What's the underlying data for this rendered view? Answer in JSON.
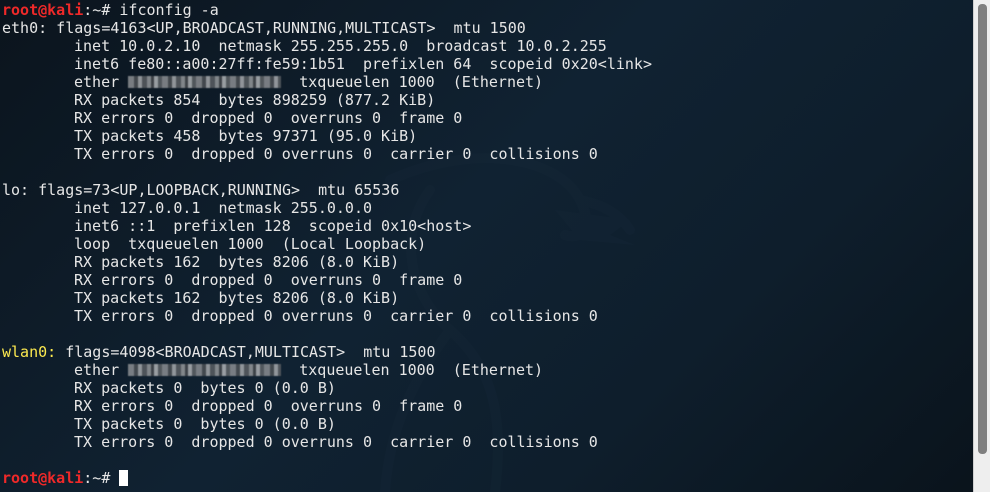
{
  "prompt": {
    "user": "root",
    "at": "@",
    "host": "kali",
    "sep": ":~# "
  },
  "command": "ifconfig -a",
  "eth0": {
    "header": "eth0: flags=4163<UP,BROADCAST,RUNNING,MULTICAST>  mtu 1500",
    "inet": "inet 10.0.2.10  netmask 255.255.255.0  broadcast 10.0.2.255",
    "inet6": "inet6 fe80::a00:27ff:fe59:1b51  prefixlen 64  scopeid 0x20<link>",
    "ether_label": "ether",
    "ether_rest": "txqueuelen 1000  (Ethernet)",
    "rx_packets": "RX packets 854  bytes 898259 (877.2 KiB)",
    "rx_errors": "RX errors 0  dropped 0  overruns 0  frame 0",
    "tx_packets": "TX packets 458  bytes 97371 (95.0 KiB)",
    "tx_errors": "TX errors 0  dropped 0 overruns 0  carrier 0  collisions 0"
  },
  "lo": {
    "header": "lo: flags=73<UP,LOOPBACK,RUNNING>  mtu 65536",
    "inet": "inet 127.0.0.1  netmask 255.0.0.0",
    "inet6": "inet6 ::1  prefixlen 128  scopeid 0x10<host>",
    "loop": "loop  txqueuelen 1000  (Local Loopback)",
    "rx_packets": "RX packets 162  bytes 8206 (8.0 KiB)",
    "rx_errors": "RX errors 0  dropped 0  overruns 0  frame 0",
    "tx_packets": "TX packets 162  bytes 8206 (8.0 KiB)",
    "tx_errors": "TX errors 0  dropped 0 overruns 0  carrier 0  collisions 0"
  },
  "wlan0": {
    "name": "wlan0:",
    "header_rest": " flags=4098<BROADCAST,MULTICAST>  mtu 1500",
    "ether_label": "ether",
    "ether_rest": "txqueuelen 1000  (Ethernet)",
    "rx_packets": "RX packets 0  bytes 0 (0.0 B)",
    "rx_errors": "RX errors 0  dropped 0  overruns 0  frame 0",
    "tx_packets": "TX packets 0  bytes 0 (0.0 B)",
    "tx_errors": "TX errors 0  dropped 0 overruns 0  carrier 0  collisions 0"
  },
  "colors": {
    "background": "#102232",
    "text": "#e6e6e6",
    "prompt": "#ef2929",
    "interface_highlight": "#fce94f",
    "scrollbar": "#eeeeee"
  },
  "icons": {
    "background_logo": "kali-dragon-icon"
  }
}
